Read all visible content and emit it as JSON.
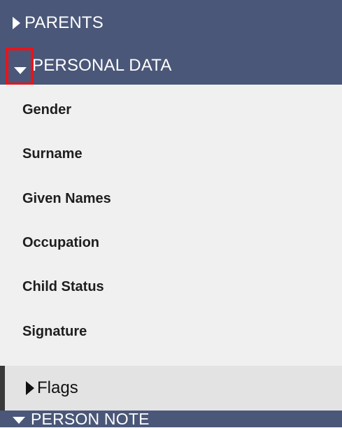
{
  "sections": {
    "parents": {
      "label": "PARENTS",
      "icon": "caret-right-icon"
    },
    "personal_data": {
      "label": "PERSONAL DATA",
      "icon": "caret-down-icon",
      "expanded": true
    },
    "person_note": {
      "label": "PERSON NOTE",
      "icon": "caret-down-icon"
    }
  },
  "fields": [
    {
      "label": "Gender"
    },
    {
      "label": "Surname"
    },
    {
      "label": "Given Names"
    },
    {
      "label": "Occupation"
    },
    {
      "label": "Child Status"
    },
    {
      "label": "Signature"
    }
  ],
  "flags": {
    "label": "Flags",
    "icon": "caret-right-icon"
  },
  "colors": {
    "header_bg": "#4a5778",
    "list_bg": "#f0f0f0",
    "flags_bg": "#e3e3e3",
    "highlight": "#e8141c"
  }
}
